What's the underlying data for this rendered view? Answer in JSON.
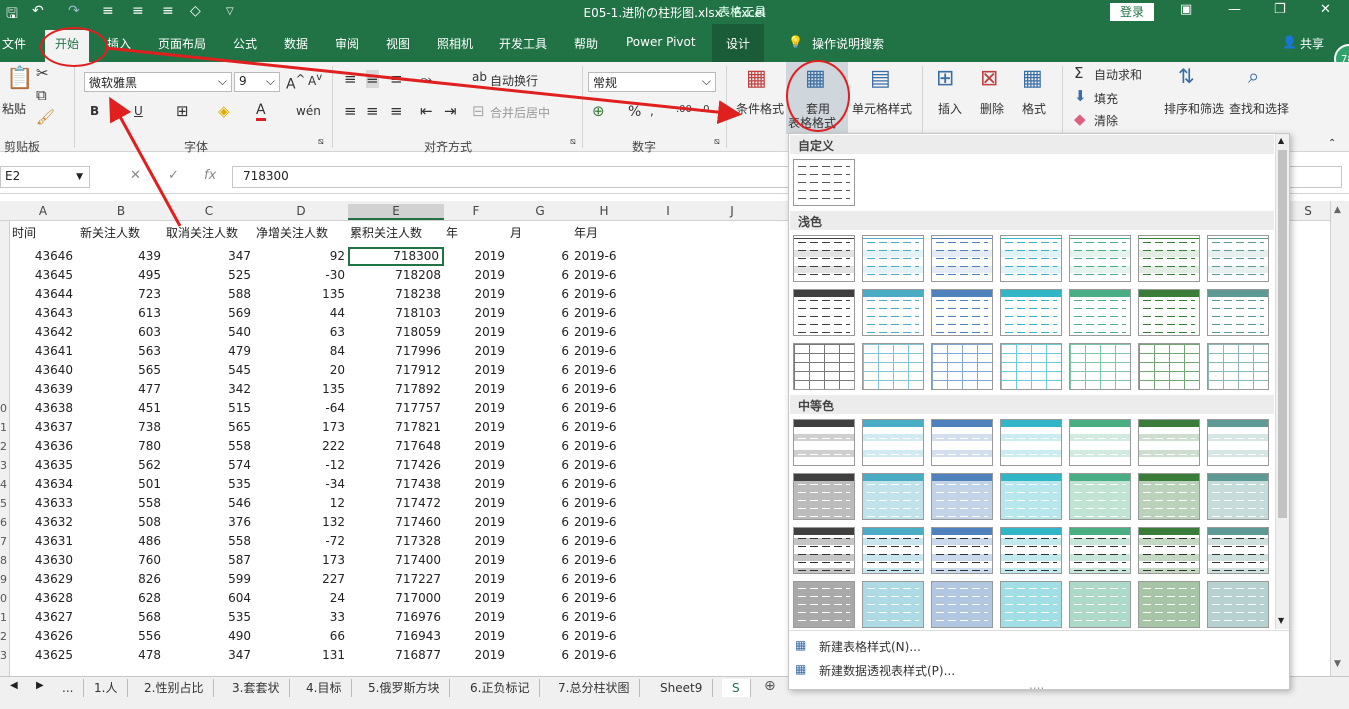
{
  "titlebar": {
    "title": "E05-1.进阶の柱形图.xlsx  -  Excel",
    "context_tools": "表格工具",
    "login": "登录"
  },
  "tabs": [
    "文件",
    "开始",
    "插入",
    "页面布局",
    "公式",
    "数据",
    "审阅",
    "视图",
    "照相机",
    "开发工具",
    "帮助",
    "Power Pivot",
    "设计"
  ],
  "tell_me": "操作说明搜索",
  "share": "共享",
  "ribbon": {
    "clipboard": {
      "paste": "粘贴",
      "group": "剪贴板"
    },
    "font": {
      "name": "微软雅黑",
      "size": "9",
      "bold": "B",
      "underline": "U",
      "fontcolor": "A",
      "group": "字体"
    },
    "align": {
      "wrap": "自动换行",
      "merge": "合并后居中",
      "group": "对齐方式"
    },
    "number": {
      "format": "常规",
      "percent": "%",
      "group": "数字"
    },
    "styles": {
      "conditional": "条件格式",
      "table_format_1": "套用",
      "table_format_2": "表格格式",
      "cell_styles": "单元格样式"
    },
    "cells": {
      "insert": "插入",
      "delete": "删除",
      "format": "格式"
    },
    "editing": {
      "autosum": "自动求和",
      "fill": "填充",
      "clear": "清除",
      "sort": "排序和筛选",
      "find": "查找和选择"
    }
  },
  "formula_bar": {
    "namebox": "E2",
    "fx": "fx",
    "value": "718300"
  },
  "columns": [
    "A",
    "B",
    "C",
    "D",
    "E",
    "F",
    "G",
    "H",
    "I",
    "J",
    "S"
  ],
  "header_row": [
    "时间",
    "新关注人数",
    "取消关注人数",
    "净增关注人数",
    "累积关注人数",
    "年",
    "月",
    "年月"
  ],
  "rows": [
    [
      "43646",
      "439",
      "347",
      "92",
      "718300",
      "2019",
      "6",
      "2019-6"
    ],
    [
      "43645",
      "495",
      "525",
      "-30",
      "718208",
      "2019",
      "6",
      "2019-6"
    ],
    [
      "43644",
      "723",
      "588",
      "135",
      "718238",
      "2019",
      "6",
      "2019-6"
    ],
    [
      "43643",
      "613",
      "569",
      "44",
      "718103",
      "2019",
      "6",
      "2019-6"
    ],
    [
      "43642",
      "603",
      "540",
      "63",
      "718059",
      "2019",
      "6",
      "2019-6"
    ],
    [
      "43641",
      "563",
      "479",
      "84",
      "717996",
      "2019",
      "6",
      "2019-6"
    ],
    [
      "43640",
      "565",
      "545",
      "20",
      "717912",
      "2019",
      "6",
      "2019-6"
    ],
    [
      "43639",
      "477",
      "342",
      "135",
      "717892",
      "2019",
      "6",
      "2019-6"
    ],
    [
      "43638",
      "451",
      "515",
      "-64",
      "717757",
      "2019",
      "6",
      "2019-6"
    ],
    [
      "43637",
      "738",
      "565",
      "173",
      "717821",
      "2019",
      "6",
      "2019-6"
    ],
    [
      "43636",
      "780",
      "558",
      "222",
      "717648",
      "2019",
      "6",
      "2019-6"
    ],
    [
      "43635",
      "562",
      "574",
      "-12",
      "717426",
      "2019",
      "6",
      "2019-6"
    ],
    [
      "43634",
      "501",
      "535",
      "-34",
      "717438",
      "2019",
      "6",
      "2019-6"
    ],
    [
      "43633",
      "558",
      "546",
      "12",
      "717472",
      "2019",
      "6",
      "2019-6"
    ],
    [
      "43632",
      "508",
      "376",
      "132",
      "717460",
      "2019",
      "6",
      "2019-6"
    ],
    [
      "43631",
      "486",
      "558",
      "-72",
      "717328",
      "2019",
      "6",
      "2019-6"
    ],
    [
      "43630",
      "760",
      "587",
      "173",
      "717400",
      "2019",
      "6",
      "2019-6"
    ],
    [
      "43629",
      "826",
      "599",
      "227",
      "717227",
      "2019",
      "6",
      "2019-6"
    ],
    [
      "43628",
      "628",
      "604",
      "24",
      "717000",
      "2019",
      "6",
      "2019-6"
    ],
    [
      "43627",
      "568",
      "535",
      "33",
      "716976",
      "2019",
      "6",
      "2019-6"
    ],
    [
      "43626",
      "556",
      "490",
      "66",
      "716943",
      "2019",
      "6",
      "2019-6"
    ],
    [
      "43625",
      "478",
      "347",
      "131",
      "716877",
      "2019",
      "6",
      "2019-6"
    ]
  ],
  "row_numbers": [
    "",
    "",
    "",
    "",
    "",
    "",
    "",
    "",
    "0",
    "1",
    "2",
    "3",
    "4",
    "5",
    "6",
    "7",
    "8",
    "9",
    "0",
    "1",
    "2",
    "3"
  ],
  "sheet_tabs": [
    "...",
    "1.人",
    "2.性别占比",
    "3.套套状",
    "4.目标",
    "5.俄罗斯方块",
    "6.正负标记",
    "7.总分柱状图",
    "Sheet9",
    "S"
  ],
  "gallery": {
    "sections": [
      "自定义",
      "浅色",
      "中等色"
    ],
    "footer": [
      "新建表格样式(N)...",
      "新建数据透视表样式(P)..."
    ],
    "colors": [
      "#404040",
      "#4bacc6",
      "#4f81bd",
      "#31b6c8",
      "#4aae84",
      "#3a7d3a",
      "#5d9a96"
    ]
  }
}
